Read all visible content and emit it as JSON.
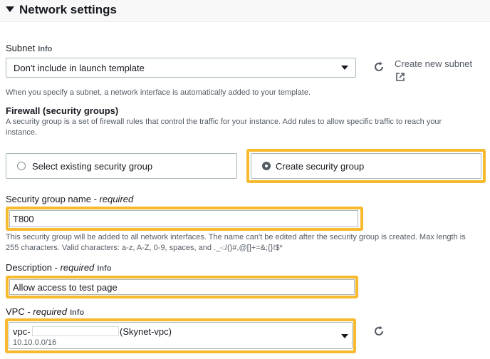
{
  "section": {
    "title": "Network settings"
  },
  "subnet": {
    "label": "Subnet",
    "info": "Info",
    "value": "Don't include in launch template",
    "create_link": "Create new subnet",
    "hint": "When you specify a subnet, a network interface is automatically added to your template."
  },
  "firewall": {
    "heading": "Firewall (security groups)",
    "description_line1": "A security group is a set of firewall rules that control the traffic for your instance. Add rules to allow specific traffic to reach your",
    "description_line2": "instance.",
    "options": [
      {
        "label": "Select existing security group",
        "selected": false
      },
      {
        "label": "Create security group",
        "selected": true
      }
    ]
  },
  "sg_name": {
    "label": "Security group name -",
    "required": "required",
    "value": "T800",
    "hint_line1": "This security group will be added to all network interfaces. The name can't be edited after the security group is created. Max length is",
    "hint_line2": "255 characters. Valid characters: a-z, A-Z, 0-9, spaces, and ._-:/()#,@[]+=&;{}!$*"
  },
  "description": {
    "label": "Description -",
    "required": "required",
    "info": "Info",
    "value": "Allow access to test page"
  },
  "vpc": {
    "label": "VPC -",
    "required": "required",
    "info": "Info",
    "prefix": "vpc-",
    "name": "(Skynet-vpc)",
    "cidr": "10.10.0.0/16"
  },
  "colors": {
    "highlight": "#f7b92d",
    "text": "#16191f",
    "muted": "#545b64"
  }
}
